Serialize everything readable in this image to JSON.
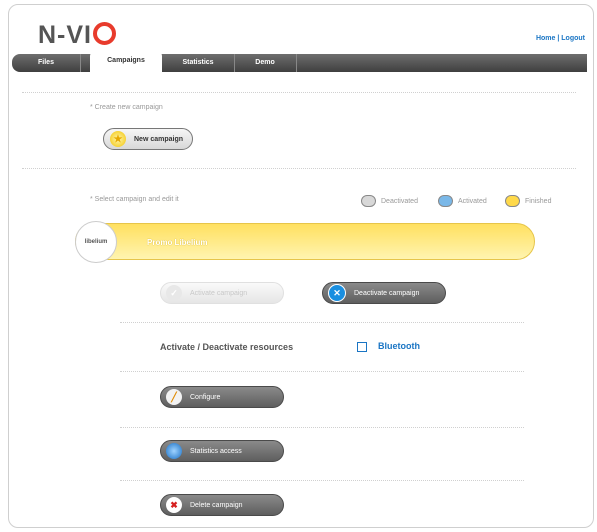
{
  "header": {
    "logo_left": "N-VI",
    "logo_text": "N-VIO",
    "home": "Home",
    "sep": " | ",
    "logout": "Logout"
  },
  "nav": {
    "tabs": [
      {
        "label": "Files",
        "active": false
      },
      {
        "label": "Campaigns",
        "active": true
      },
      {
        "label": "Statistics",
        "active": false
      },
      {
        "label": "Demo",
        "active": false
      }
    ]
  },
  "create": {
    "note": "* Create new campaign",
    "button": "New campaign"
  },
  "select": {
    "note": "* Select campaign and edit it",
    "legend": [
      {
        "label": "Deactivated",
        "color": "#d8d8d8"
      },
      {
        "label": "Activated",
        "color": "#7ab8e8"
      },
      {
        "label": "Finished",
        "color": "#ffd94a"
      }
    ]
  },
  "campaign": {
    "badge": "libelium",
    "name": "Promo Libelium",
    "color": "#ffe060"
  },
  "actions": {
    "activate": "Activate campaign",
    "deactivate": "Deactivate campaign",
    "resources_label": "Activate / Deactivate resources",
    "bluetooth": "Bluetooth",
    "configure": "Configure",
    "statistics": "Statistics access",
    "delete": "Delete campaign"
  }
}
